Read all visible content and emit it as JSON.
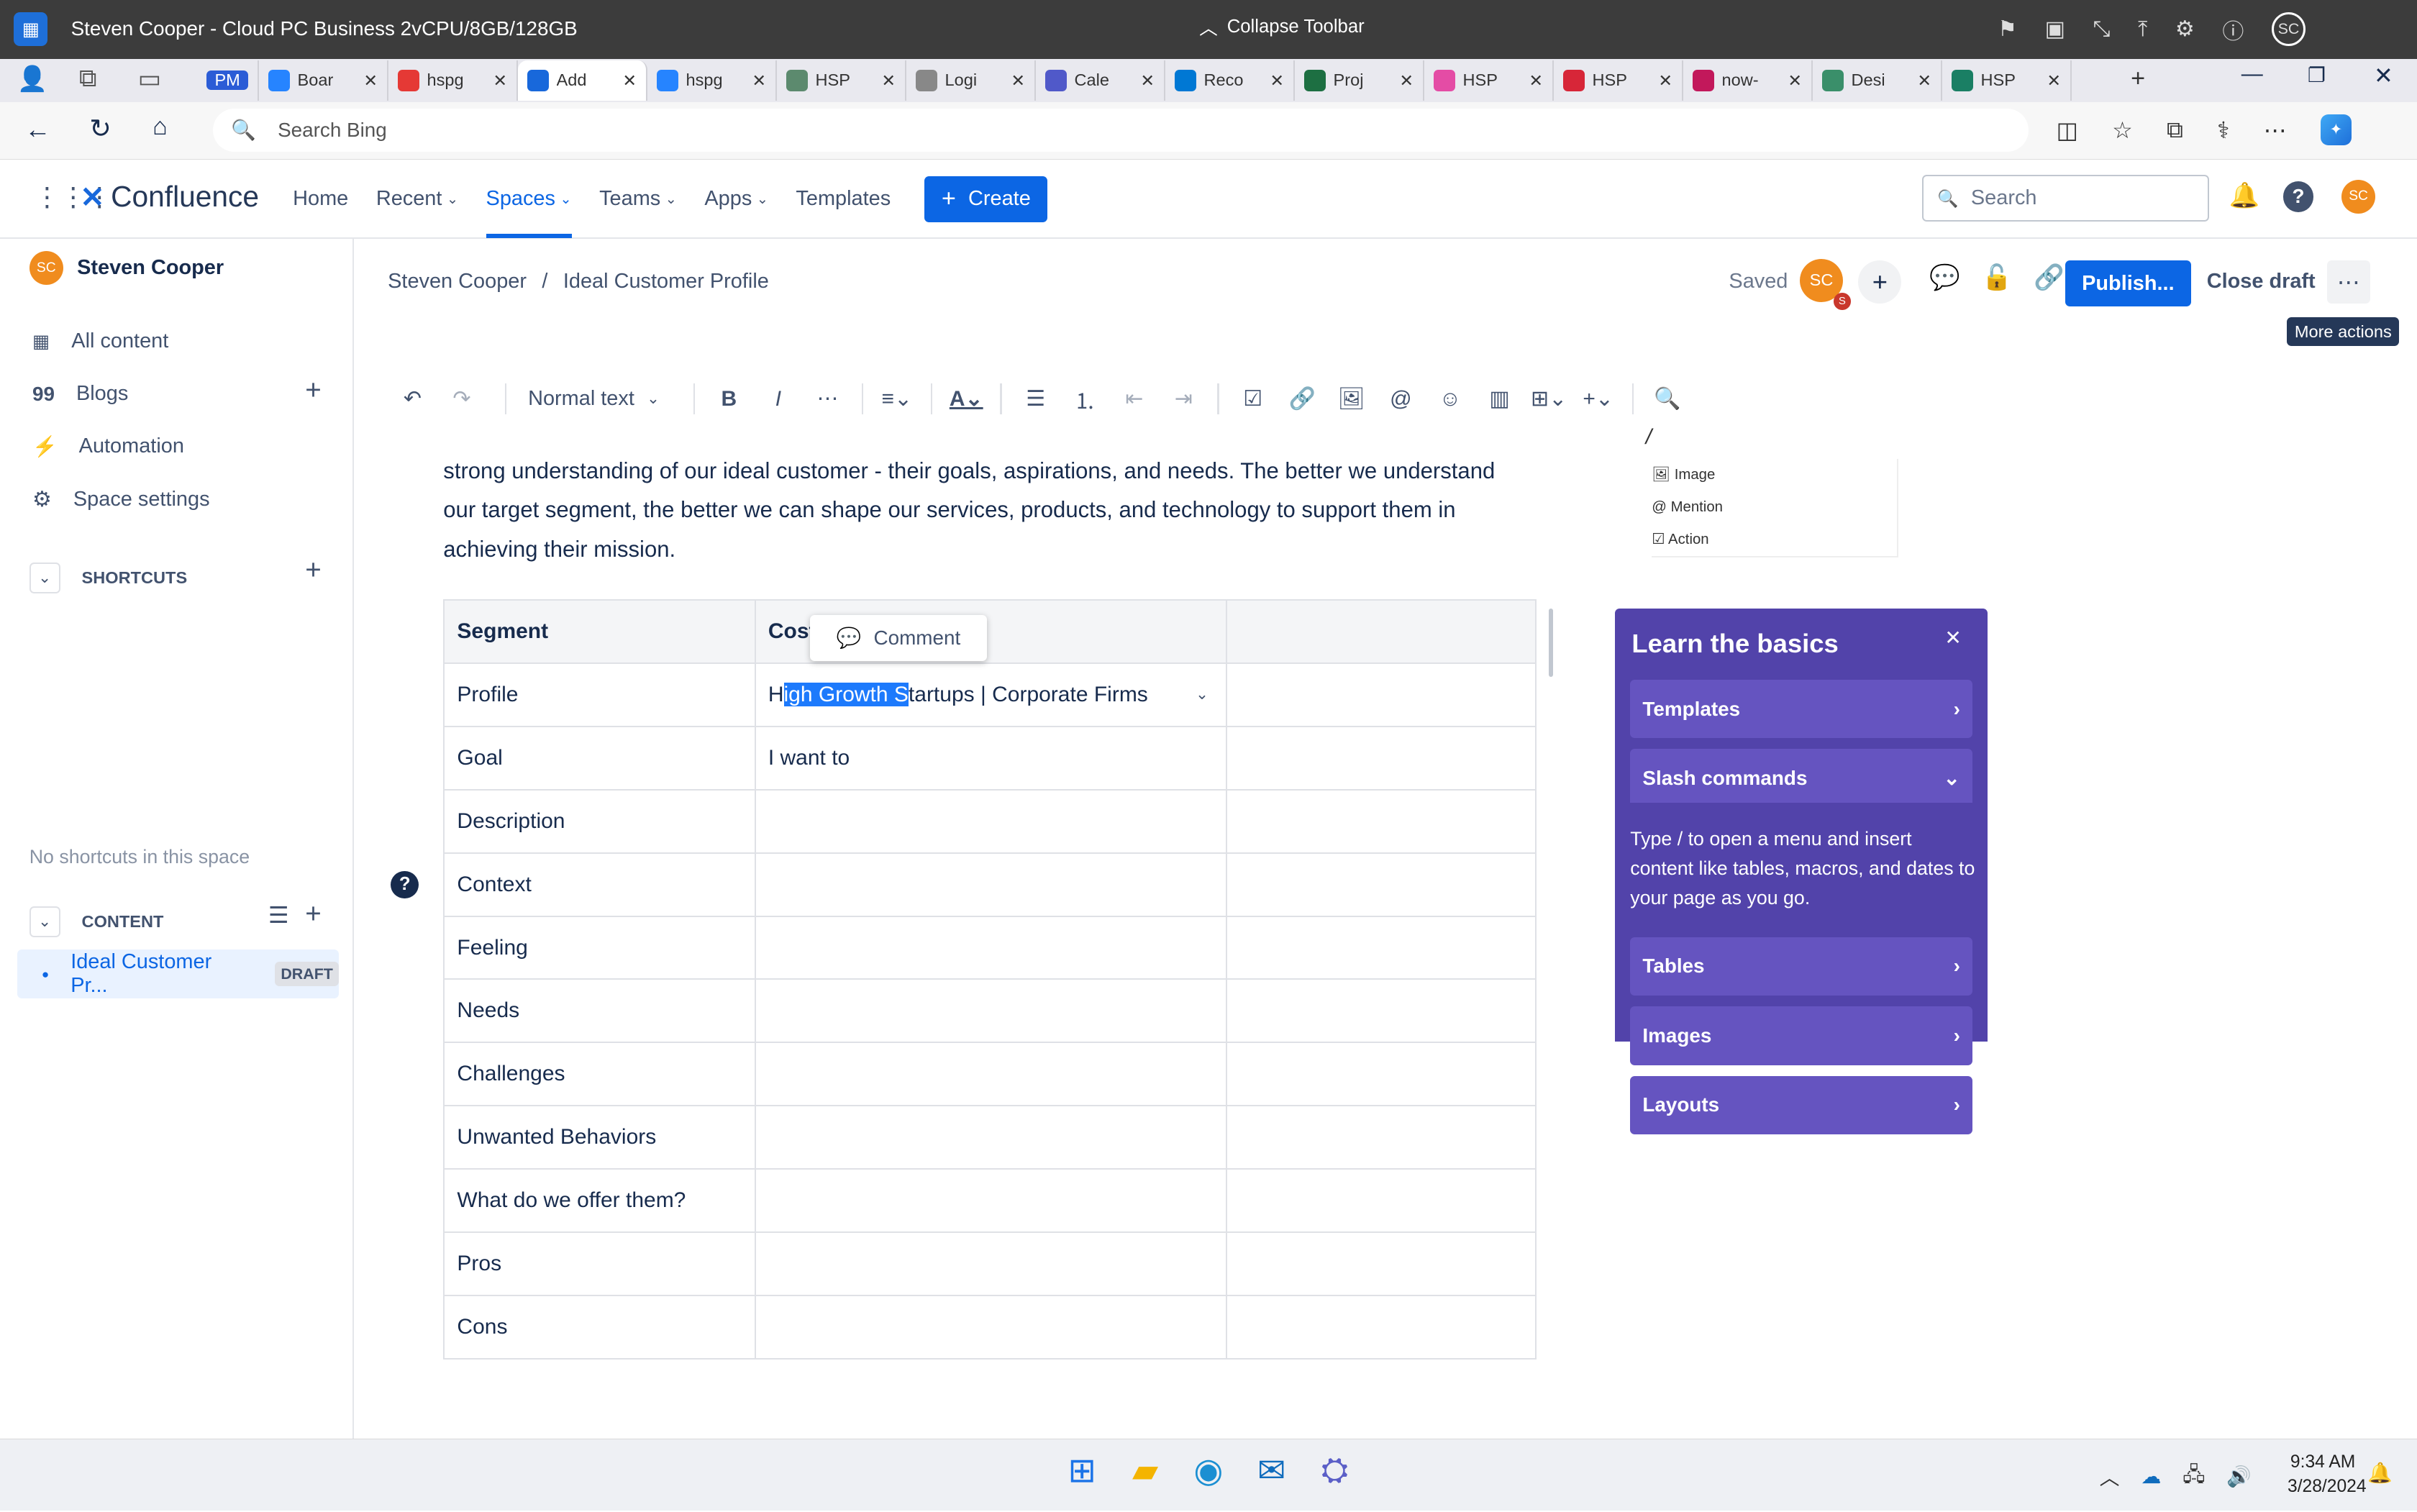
{
  "rd": {
    "title": "Steven Cooper - Cloud PC Business 2vCPU/8GB/128GB",
    "collapse": "Collapse Toolbar",
    "avatar": "SC"
  },
  "browser": {
    "tabs": [
      {
        "label": "PM",
        "color": "#2b5cd6"
      },
      {
        "label": "Boar",
        "color": "#2684ff"
      },
      {
        "label": "hspg",
        "color": "#e53935"
      },
      {
        "label": "Add",
        "color": "#1868db"
      },
      {
        "label": "hspg",
        "color": "#2684ff"
      },
      {
        "label": "HSP",
        "color": "#5c8a6e"
      },
      {
        "label": "Logi",
        "color": "#888888"
      },
      {
        "label": "Cale",
        "color": "#5059c9"
      },
      {
        "label": "Reco",
        "color": "#0078d4"
      },
      {
        "label": "Proj",
        "color": "#1d6f42"
      },
      {
        "label": "HSP",
        "color": "#e44ca5"
      },
      {
        "label": "HSP",
        "color": "#d72638"
      },
      {
        "label": "now-",
        "color": "#c2185b"
      },
      {
        "label": "Desi",
        "color": "#3a8f6a"
      },
      {
        "label": "HSP",
        "color": "#1a7f64"
      }
    ],
    "search_placeholder": "Search Bing"
  },
  "conf": {
    "logo": "Confluence",
    "nav": [
      "Home",
      "Recent",
      "Spaces",
      "Teams",
      "Apps",
      "Templates"
    ],
    "create": "Create",
    "search": "Search",
    "avatar": "SC"
  },
  "sidebar": {
    "user": "Steven Cooper",
    "avatar": "SC",
    "items": [
      "All content",
      "Blogs",
      "Automation",
      "Space settings"
    ],
    "shortcuts": "SHORTCUTS",
    "no_shortcuts": "No shortcuts in this space",
    "content": "CONTENT",
    "page": "Ideal Customer Pr...",
    "badge": "DRAFT"
  },
  "page": {
    "crumb1": "Steven Cooper",
    "sep": "/",
    "crumb2": "Ideal Customer Profile",
    "saved": "Saved",
    "avatar": "SC",
    "avatar_badge": "S",
    "publish": "Publish...",
    "close": "Close draft",
    "tooltip": "More actions",
    "text_style": "Normal text",
    "para": [
      "strong understanding of our ideal customer - their goals, aspirations, and needs. The better we understand",
      "our target segment, the better we can shape our services, products, and technology to support them in",
      "achieving their mission."
    ],
    "table": {
      "headers": [
        "Segment",
        "Cost",
        ""
      ],
      "comment": "Comment",
      "profile": {
        "pre": "H",
        "sel": "igh Growth S",
        "post": "tartups | Corporate Firms"
      },
      "rows": [
        [
          "Profile",
          ""
        ],
        [
          "Goal",
          "I want to"
        ],
        [
          "Description",
          ""
        ],
        [
          "Context",
          ""
        ],
        [
          "Feeling",
          ""
        ],
        [
          "Needs",
          ""
        ],
        [
          "Challenges",
          ""
        ],
        [
          "Unwanted Behaviors",
          ""
        ],
        [
          "What do we offer them?",
          ""
        ],
        [
          "Pros",
          ""
        ],
        [
          "Cons",
          ""
        ]
      ]
    }
  },
  "learn": {
    "title": "Learn the basics",
    "sections": [
      "Templates",
      "Slash commands"
    ],
    "slash": "/",
    "menu": [
      "Image",
      "Mention",
      "Action"
    ],
    "desc": "Type / to open a menu and insert content like tables, macros, and dates to your page as you go.",
    "more": [
      "Tables",
      "Images",
      "Layouts"
    ]
  },
  "taskbar": {
    "time": "9:34 AM",
    "date": "3/28/2024"
  }
}
